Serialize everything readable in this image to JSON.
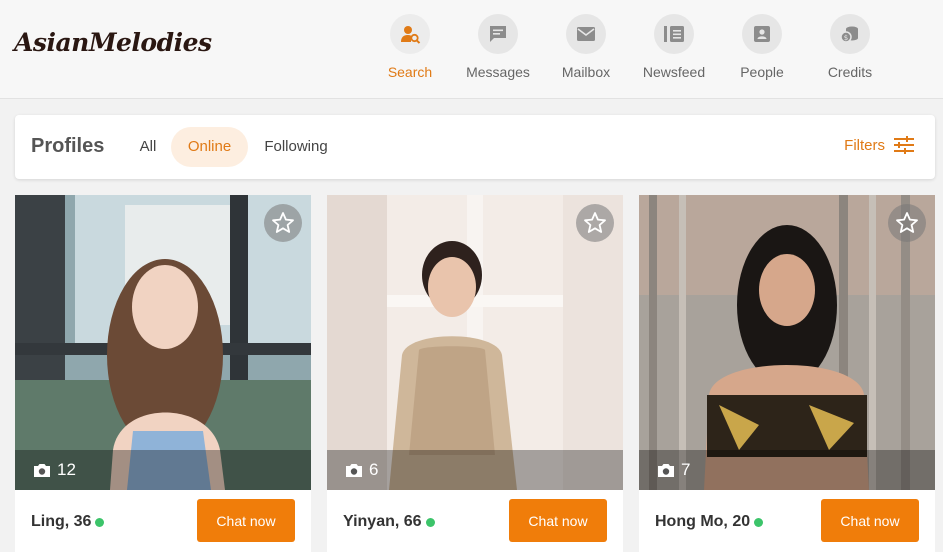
{
  "brand": {
    "logo_text": "AsianMelodies"
  },
  "nav": {
    "items": [
      {
        "label": "Search",
        "icon": "search-user-icon",
        "active": true
      },
      {
        "label": "Messages",
        "icon": "message-icon"
      },
      {
        "label": "Mailbox",
        "icon": "mail-icon"
      },
      {
        "label": "Newsfeed",
        "icon": "newsfeed-icon"
      },
      {
        "label": "People",
        "icon": "people-icon"
      },
      {
        "label": "Credits",
        "icon": "credits-icon"
      }
    ]
  },
  "filterbar": {
    "title": "Profiles",
    "tabs": [
      {
        "label": "All"
      },
      {
        "label": "Online",
        "active": true
      },
      {
        "label": "Following"
      }
    ],
    "filters_label": "Filters"
  },
  "profiles": [
    {
      "name": "Ling, 36",
      "photo_count": "12",
      "online": true,
      "chat_label": "Chat now"
    },
    {
      "name": "Yinyan, 66",
      "photo_count": "6",
      "online": true,
      "chat_label": "Chat now"
    },
    {
      "name": "Hong Mo, 20",
      "photo_count": "7",
      "online": true,
      "chat_label": "Chat now"
    }
  ],
  "colors": {
    "accent": "#f07d0a",
    "active_text": "#e07a16",
    "online": "#3cc46a"
  }
}
